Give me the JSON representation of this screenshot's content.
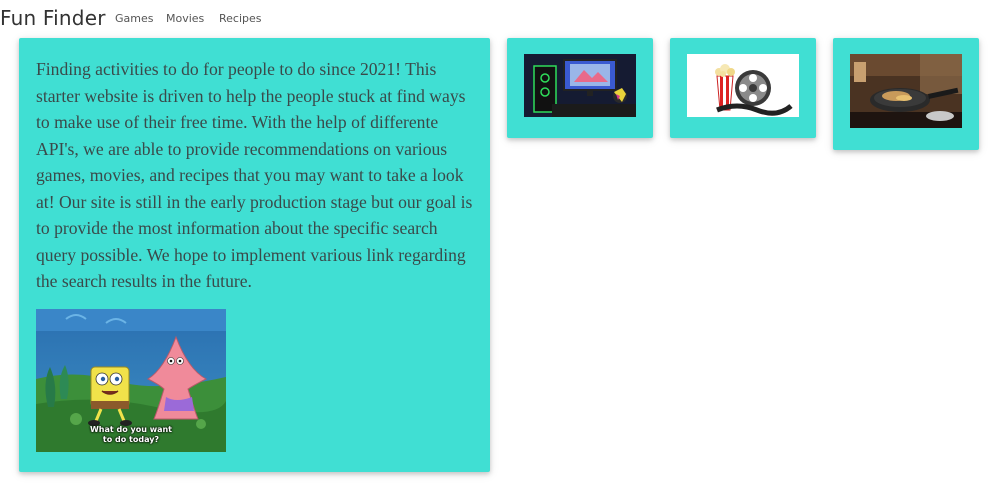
{
  "navbar": {
    "brand": "Fun Finder",
    "links": [
      "Games",
      "Movies",
      "Recipes"
    ]
  },
  "intro": {
    "text": "Finding activities to do for people to do since 2021! This starter website is driven to help the people stuck at find ways to make use of their free time. With the help of differente API's, we are able to provide recommendations on various games, movies, and recipes that you may want to take a look at! Our site is still in the early production stage but our goal is to provide the most information about the specific search query possible. We hope to implement various link regarding the search results in the future.",
    "gif_caption_line1": "What do you want",
    "gif_caption_line2": "to do today?"
  },
  "cards": [
    {
      "name": "games",
      "image": "gaming-setup-icon"
    },
    {
      "name": "movies",
      "image": "popcorn-film-reel-icon"
    },
    {
      "name": "recipes",
      "image": "cooking-pan-icon"
    }
  ],
  "colors": {
    "card_background": "#40dfd3",
    "page_background": "#ffffff",
    "text": "#333333"
  }
}
